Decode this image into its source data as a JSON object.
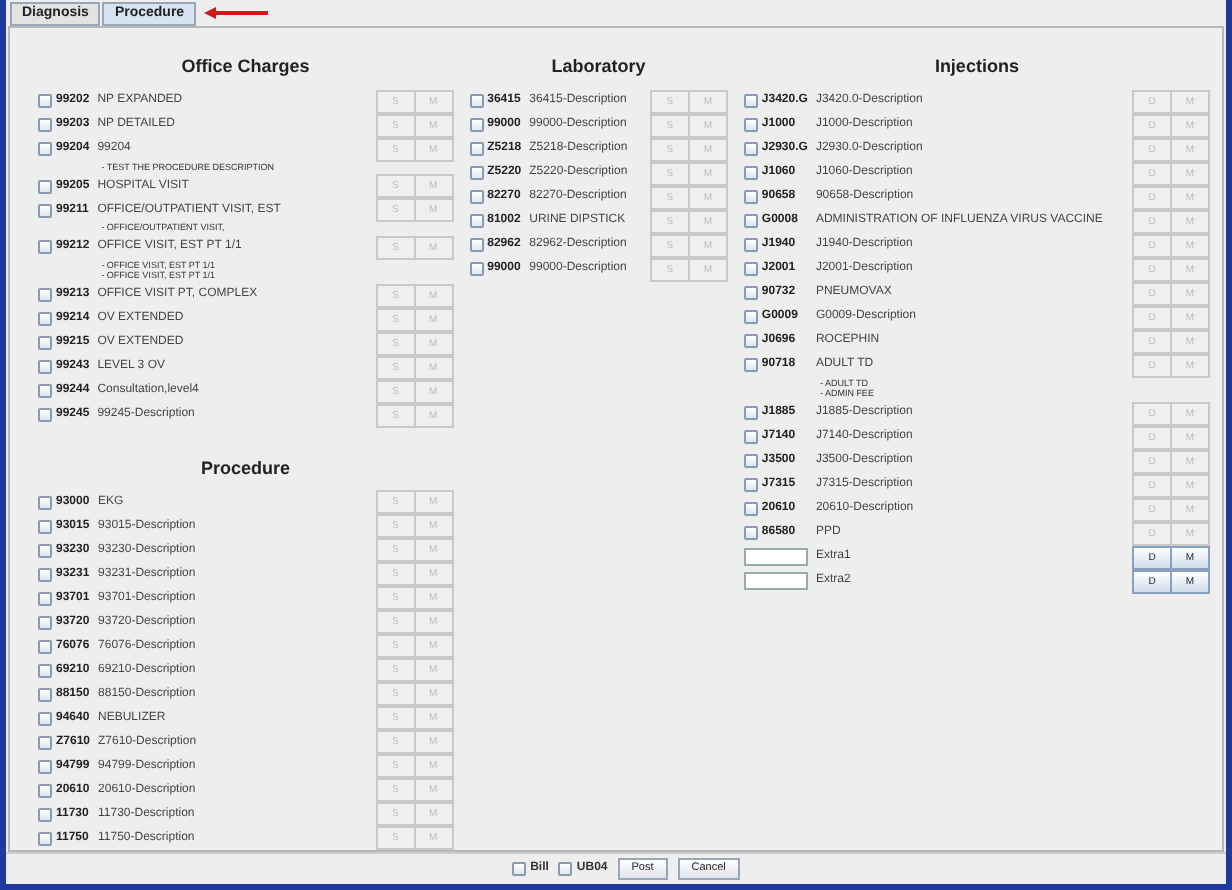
{
  "tabs": [
    {
      "label": "Diagnosis",
      "selected": false
    },
    {
      "label": "Procedure",
      "selected": true
    }
  ],
  "columns": [
    {
      "sections": [
        {
          "title": "Office Charges",
          "items": [
            {
              "kind": "code",
              "code": "99202",
              "description": "NP EXPANDED",
              "checked": false,
              "buttons": [
                {
                  "label": "S",
                  "disabled": true
                },
                {
                  "label": "M",
                  "disabled": true
                }
              ]
            },
            {
              "kind": "code",
              "code": "99203",
              "description": "NP DETAILED",
              "checked": false,
              "buttons": [
                {
                  "label": "S",
                  "disabled": true
                },
                {
                  "label": "M",
                  "disabled": true
                }
              ]
            },
            {
              "kind": "code",
              "code": "99204",
              "description": "99204",
              "checked": false,
              "notes": [
                "- TEST THE PROCEDURE DESCRIPTION"
              ],
              "buttons": [
                {
                  "label": "S",
                  "disabled": true
                },
                {
                  "label": "M",
                  "disabled": true
                }
              ]
            },
            {
              "kind": "code",
              "code": "99205",
              "description": "HOSPITAL VISIT",
              "checked": false,
              "buttons": [
                {
                  "label": "S",
                  "disabled": true
                },
                {
                  "label": "M",
                  "disabled": true
                }
              ]
            },
            {
              "kind": "code",
              "code": "99211",
              "description": "OFFICE/OUTPATIENT VISIT, EST",
              "checked": false,
              "notes": [
                "- OFFICE/OUTPATIENT VISIT,"
              ],
              "buttons": [
                {
                  "label": "S",
                  "disabled": true
                },
                {
                  "label": "M",
                  "disabled": true
                }
              ]
            },
            {
              "kind": "code",
              "code": "99212",
              "description": "OFFICE VISIT, EST PT 1/1",
              "checked": false,
              "notes": [
                "- OFFICE VISIT, EST PT 1/1",
                "- OFFICE VISIT, EST PT 1/1"
              ],
              "buttons": [
                {
                  "label": "S",
                  "disabled": true
                },
                {
                  "label": "M",
                  "disabled": true
                }
              ]
            },
            {
              "kind": "code",
              "code": "99213",
              "description": "OFFICE VISIT PT, COMPLEX",
              "checked": false,
              "buttons": [
                {
                  "label": "S",
                  "disabled": true
                },
                {
                  "label": "M",
                  "disabled": true
                }
              ]
            },
            {
              "kind": "code",
              "code": "99214",
              "description": "OV EXTENDED",
              "checked": false,
              "buttons": [
                {
                  "label": "S",
                  "disabled": true
                },
                {
                  "label": "M",
                  "disabled": true
                }
              ]
            },
            {
              "kind": "code",
              "code": "99215",
              "description": "OV EXTENDED",
              "checked": false,
              "buttons": [
                {
                  "label": "S",
                  "disabled": true
                },
                {
                  "label": "M",
                  "disabled": true
                }
              ]
            },
            {
              "kind": "code",
              "code": "99243",
              "description": "LEVEL 3 OV",
              "checked": false,
              "buttons": [
                {
                  "label": "S",
                  "disabled": true
                },
                {
                  "label": "M",
                  "disabled": true
                }
              ]
            },
            {
              "kind": "code",
              "code": "99244",
              "description": "Consultation,level4",
              "checked": false,
              "buttons": [
                {
                  "label": "S",
                  "disabled": true
                },
                {
                  "label": "M",
                  "disabled": true
                }
              ]
            },
            {
              "kind": "code",
              "code": "99245",
              "description": "99245-Description",
              "checked": false,
              "buttons": [
                {
                  "label": "S",
                  "disabled": true
                },
                {
                  "label": "M",
                  "disabled": true
                }
              ]
            }
          ]
        },
        {
          "title": "Procedure",
          "items": [
            {
              "kind": "code",
              "code": "93000",
              "description": "EKG",
              "checked": false,
              "buttons": [
                {
                  "label": "S",
                  "disabled": true
                },
                {
                  "label": "M",
                  "disabled": true
                }
              ]
            },
            {
              "kind": "code",
              "code": "93015",
              "description": "93015-Description",
              "checked": false,
              "buttons": [
                {
                  "label": "S",
                  "disabled": true
                },
                {
                  "label": "M",
                  "disabled": true
                }
              ]
            },
            {
              "kind": "code",
              "code": "93230",
              "description": "93230-Description",
              "checked": false,
              "buttons": [
                {
                  "label": "S",
                  "disabled": true
                },
                {
                  "label": "M",
                  "disabled": true
                }
              ]
            },
            {
              "kind": "code",
              "code": "93231",
              "description": "93231-Description",
              "checked": false,
              "buttons": [
                {
                  "label": "S",
                  "disabled": true
                },
                {
                  "label": "M",
                  "disabled": true
                }
              ]
            },
            {
              "kind": "code",
              "code": "93701",
              "description": "93701-Description",
              "checked": false,
              "buttons": [
                {
                  "label": "S",
                  "disabled": true
                },
                {
                  "label": "M",
                  "disabled": true
                }
              ]
            },
            {
              "kind": "code",
              "code": "93720",
              "description": "93720-Description",
              "checked": false,
              "buttons": [
                {
                  "label": "S",
                  "disabled": true
                },
                {
                  "label": "M",
                  "disabled": true
                }
              ]
            },
            {
              "kind": "code",
              "code": "76076",
              "description": "76076-Description",
              "checked": false,
              "buttons": [
                {
                  "label": "S",
                  "disabled": true
                },
                {
                  "label": "M",
                  "disabled": true
                }
              ]
            },
            {
              "kind": "code",
              "code": "69210",
              "description": "69210-Description",
              "checked": false,
              "buttons": [
                {
                  "label": "S",
                  "disabled": true
                },
                {
                  "label": "M",
                  "disabled": true
                }
              ]
            },
            {
              "kind": "code",
              "code": "88150",
              "description": "88150-Description",
              "checked": false,
              "buttons": [
                {
                  "label": "S",
                  "disabled": true
                },
                {
                  "label": "M",
                  "disabled": true
                }
              ]
            },
            {
              "kind": "code",
              "code": "94640",
              "description": "NEBULIZER",
              "checked": false,
              "buttons": [
                {
                  "label": "S",
                  "disabled": true
                },
                {
                  "label": "M",
                  "disabled": true
                }
              ]
            },
            {
              "kind": "code",
              "code": "Z7610",
              "description": "Z7610-Description",
              "checked": false,
              "buttons": [
                {
                  "label": "S",
                  "disabled": true
                },
                {
                  "label": "M",
                  "disabled": true
                }
              ]
            },
            {
              "kind": "code",
              "code": "94799",
              "description": "94799-Description",
              "checked": false,
              "buttons": [
                {
                  "label": "S",
                  "disabled": true
                },
                {
                  "label": "M",
                  "disabled": true
                }
              ]
            },
            {
              "kind": "code",
              "code": "20610",
              "description": "20610-Description",
              "checked": false,
              "buttons": [
                {
                  "label": "S",
                  "disabled": true
                },
                {
                  "label": "M",
                  "disabled": true
                }
              ]
            },
            {
              "kind": "code",
              "code": "11730",
              "description": "11730-Description",
              "checked": false,
              "buttons": [
                {
                  "label": "S",
                  "disabled": true
                },
                {
                  "label": "M",
                  "disabled": true
                }
              ]
            },
            {
              "kind": "code",
              "code": "11750",
              "description": "11750-Description",
              "checked": false,
              "buttons": [
                {
                  "label": "S",
                  "disabled": true
                },
                {
                  "label": "M",
                  "disabled": true
                }
              ]
            }
          ]
        }
      ]
    },
    {
      "sections": [
        {
          "title": "Laboratory",
          "items": [
            {
              "kind": "code",
              "code": "36415",
              "description": "36415-Description",
              "checked": false,
              "buttons": [
                {
                  "label": "S",
                  "disabled": true
                },
                {
                  "label": "M",
                  "disabled": true
                }
              ]
            },
            {
              "kind": "code",
              "code": "99000",
              "description": "99000-Description",
              "checked": false,
              "buttons": [
                {
                  "label": "S",
                  "disabled": true
                },
                {
                  "label": "M",
                  "disabled": true
                }
              ]
            },
            {
              "kind": "code",
              "code": "Z5218",
              "description": "Z5218-Description",
              "checked": false,
              "buttons": [
                {
                  "label": "S",
                  "disabled": true
                },
                {
                  "label": "M",
                  "disabled": true
                }
              ]
            },
            {
              "kind": "code",
              "code": "Z5220",
              "description": "Z5220-Description",
              "checked": false,
              "buttons": [
                {
                  "label": "S",
                  "disabled": true
                },
                {
                  "label": "M",
                  "disabled": true
                }
              ]
            },
            {
              "kind": "code",
              "code": "82270",
              "description": "82270-Description",
              "checked": false,
              "buttons": [
                {
                  "label": "S",
                  "disabled": true
                },
                {
                  "label": "M",
                  "disabled": true
                }
              ]
            },
            {
              "kind": "code",
              "code": "81002",
              "description": "URINE DIPSTICK",
              "checked": false,
              "buttons": [
                {
                  "label": "S",
                  "disabled": true
                },
                {
                  "label": "M",
                  "disabled": true
                }
              ]
            },
            {
              "kind": "code",
              "code": "82962",
              "description": "82962-Description",
              "checked": false,
              "buttons": [
                {
                  "label": "S",
                  "disabled": true
                },
                {
                  "label": "M",
                  "disabled": true
                }
              ]
            },
            {
              "kind": "code",
              "code": "99000",
              "description": "99000-Description",
              "checked": false,
              "buttons": [
                {
                  "label": "S",
                  "disabled": true
                },
                {
                  "label": "M",
                  "disabled": true
                }
              ]
            }
          ]
        }
      ]
    },
    {
      "sections": [
        {
          "title": "Injections",
          "items": [
            {
              "kind": "code",
              "code": "J3420.G",
              "description": "J3420.0-Description",
              "checked": false,
              "buttons": [
                {
                  "label": "D",
                  "disabled": true
                },
                {
                  "label": "M",
                  "disabled": true
                }
              ]
            },
            {
              "kind": "code",
              "code": "J1000",
              "description": "J1000-Description",
              "checked": false,
              "buttons": [
                {
                  "label": "D",
                  "disabled": true
                },
                {
                  "label": "M",
                  "disabled": true
                }
              ]
            },
            {
              "kind": "code",
              "code": "J2930.G",
              "description": "J2930.0-Description",
              "checked": false,
              "buttons": [
                {
                  "label": "D",
                  "disabled": true
                },
                {
                  "label": "M",
                  "disabled": true
                }
              ]
            },
            {
              "kind": "code",
              "code": "J1060",
              "description": "J1060-Description",
              "checked": false,
              "buttons": [
                {
                  "label": "D",
                  "disabled": true
                },
                {
                  "label": "M",
                  "disabled": true
                }
              ]
            },
            {
              "kind": "code",
              "code": "90658",
              "description": "90658-Description",
              "checked": false,
              "buttons": [
                {
                  "label": "D",
                  "disabled": true
                },
                {
                  "label": "M",
                  "disabled": true
                }
              ]
            },
            {
              "kind": "code",
              "code": "G0008",
              "description": "ADMINISTRATION OF INFLUENZA VIRUS VACCINE",
              "checked": false,
              "buttons": [
                {
                  "label": "D",
                  "disabled": true
                },
                {
                  "label": "M",
                  "disabled": true
                }
              ]
            },
            {
              "kind": "code",
              "code": "J1940",
              "description": "J1940-Description",
              "checked": false,
              "buttons": [
                {
                  "label": "D",
                  "disabled": true
                },
                {
                  "label": "M",
                  "disabled": true
                }
              ]
            },
            {
              "kind": "code",
              "code": "J2001",
              "description": "J2001-Description",
              "checked": false,
              "buttons": [
                {
                  "label": "D",
                  "disabled": true
                },
                {
                  "label": "M",
                  "disabled": true
                }
              ]
            },
            {
              "kind": "code",
              "code": "90732",
              "description": "PNEUMOVAX",
              "checked": false,
              "buttons": [
                {
                  "label": "D",
                  "disabled": true
                },
                {
                  "label": "M",
                  "disabled": true
                }
              ]
            },
            {
              "kind": "code",
              "code": "G0009",
              "description": "G0009-Description",
              "checked": false,
              "buttons": [
                {
                  "label": "D",
                  "disabled": true
                },
                {
                  "label": "M",
                  "disabled": true
                }
              ]
            },
            {
              "kind": "code",
              "code": "J0696",
              "description": "ROCEPHIN",
              "checked": false,
              "buttons": [
                {
                  "label": "D",
                  "disabled": true
                },
                {
                  "label": "M",
                  "disabled": true
                }
              ]
            },
            {
              "kind": "code",
              "code": "90718",
              "description": "ADULT TD",
              "checked": false,
              "notes": [
                "- ADULT TD",
                "- ADMIN FEE"
              ],
              "buttons": [
                {
                  "label": "D",
                  "disabled": true
                },
                {
                  "label": "M",
                  "disabled": true
                }
              ]
            },
            {
              "kind": "code",
              "code": "J1885",
              "description": "J1885-Description",
              "checked": false,
              "buttons": [
                {
                  "label": "D",
                  "disabled": true
                },
                {
                  "label": "M",
                  "disabled": true
                }
              ]
            },
            {
              "kind": "code",
              "code": "J7140",
              "description": "J7140-Description",
              "checked": false,
              "buttons": [
                {
                  "label": "D",
                  "disabled": true
                },
                {
                  "label": "M",
                  "disabled": true
                }
              ]
            },
            {
              "kind": "code",
              "code": "J3500",
              "description": "J3500-Description",
              "checked": false,
              "buttons": [
                {
                  "label": "D",
                  "disabled": true
                },
                {
                  "label": "M",
                  "disabled": true
                }
              ]
            },
            {
              "kind": "code",
              "code": "J7315",
              "description": "J7315-Description",
              "checked": false,
              "buttons": [
                {
                  "label": "D",
                  "disabled": true
                },
                {
                  "label": "M",
                  "disabled": true
                }
              ]
            },
            {
              "kind": "code",
              "code": "20610",
              "description": "20610-Description",
              "checked": false,
              "buttons": [
                {
                  "label": "D",
                  "disabled": true
                },
                {
                  "label": "M",
                  "disabled": true
                }
              ]
            },
            {
              "kind": "code",
              "code": "86580",
              "description": "PPD",
              "checked": false,
              "buttons": [
                {
                  "label": "D",
                  "disabled": true
                },
                {
                  "label": "M",
                  "disabled": true
                }
              ]
            },
            {
              "kind": "extra",
              "description": "Extra1",
              "buttons": [
                {
                  "label": "D",
                  "disabled": false
                },
                {
                  "label": "M",
                  "disabled": false
                }
              ]
            },
            {
              "kind": "extra",
              "description": "Extra2",
              "buttons": [
                {
                  "label": "D",
                  "disabled": false
                },
                {
                  "label": "M",
                  "disabled": false
                }
              ]
            }
          ]
        }
      ]
    }
  ],
  "footer": {
    "checkboxes": [
      {
        "label": "Bill",
        "checked": false
      },
      {
        "label": "UB04",
        "checked": false
      }
    ],
    "buttons": [
      "Post",
      "Cancel"
    ]
  }
}
